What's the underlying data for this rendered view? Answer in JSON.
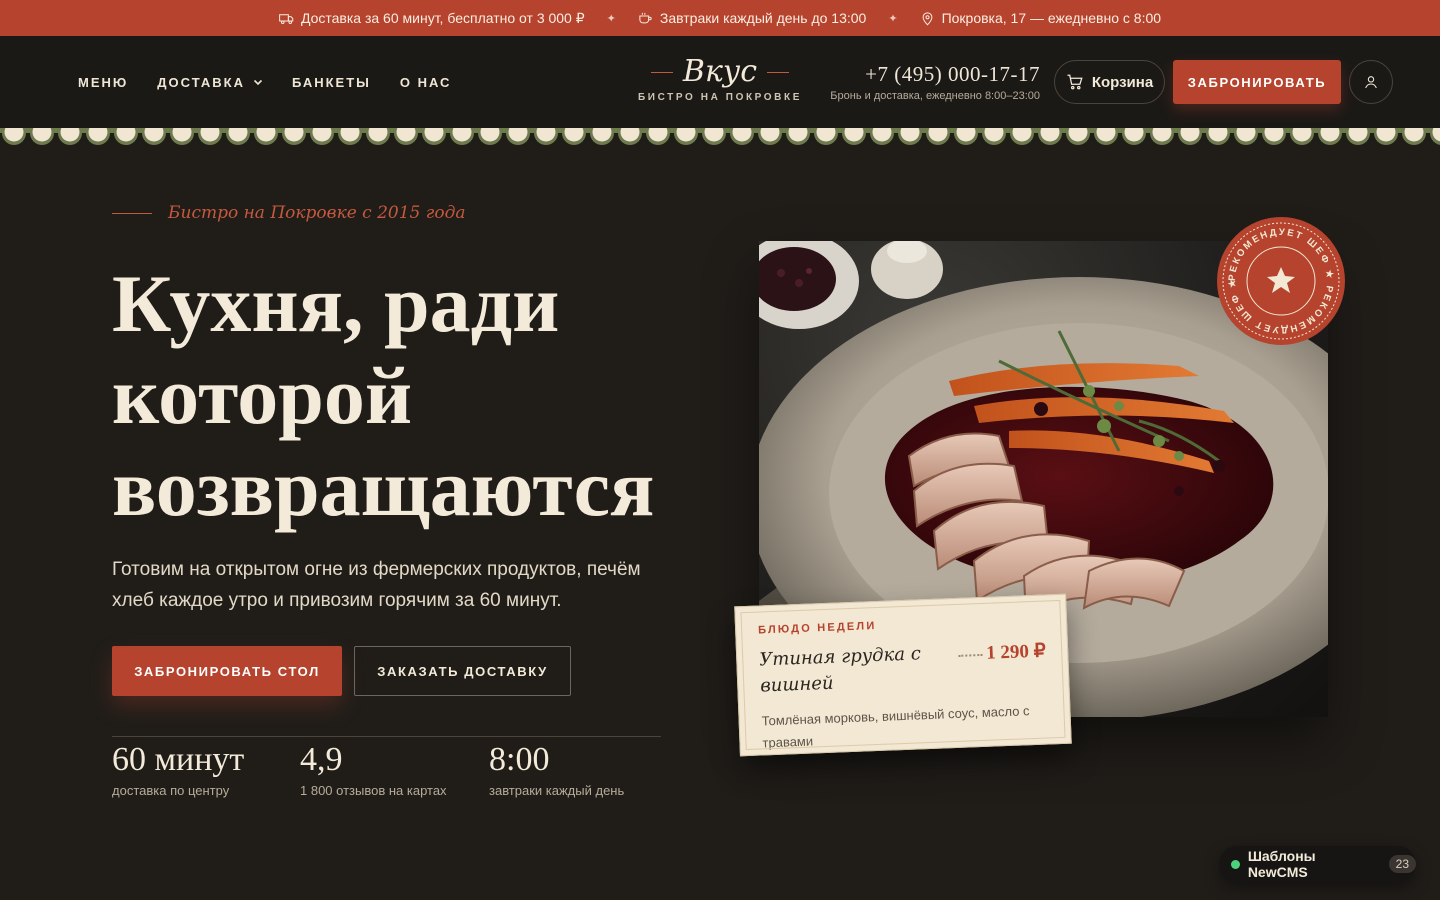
{
  "topbar": {
    "delivery": "Доставка за 60 минут, бесплатно от 3 000 ₽",
    "breakfast": "Завтраки каждый день до 13:00",
    "address": "Покровка, 17 — ежедневно с 8:00",
    "separator": "✦"
  },
  "nav": {
    "menu": "МЕНЮ",
    "delivery": "ДОСТАВКА",
    "banquets": "БАНКЕТЫ",
    "about": "О НАС"
  },
  "logo": {
    "name": "Вкус",
    "subtitle": "БИСТРО НА ПОКРОВКЕ"
  },
  "contact": {
    "phone": "+7 (495) 000-17-17",
    "note": "Бронь и доставка, ежедневно 8:00–23:00"
  },
  "header_buttons": {
    "cart": "Корзина",
    "book": "ЗАБРОНИРОВАТЬ"
  },
  "hero": {
    "eyebrow": "Бистро на Покровке с 2015 года",
    "headline": [
      "Кухня, ради",
      "которой",
      "возвращаются"
    ],
    "lead": "Готовим на открытом огне из фермерских продуктов, печём хлеб каждое утро и привозим горячим за 60 минут.",
    "cta_primary": "ЗАБРОНИРОВАТЬ СТОЛ",
    "cta_secondary": "ЗАКАЗАТЬ ДОСТАВКУ",
    "stats": [
      {
        "value": "60 минут",
        "label": "доставка по центру"
      },
      {
        "value": "4,9",
        "label": "1 800 отзывов на картах"
      },
      {
        "value": "8:00",
        "label": "завтраки каждый день"
      }
    ]
  },
  "badge": {
    "text": "РЕКОМЕНДУЕТ ШЕФ ★ РЕКОМЕНДУЕТ ШЕФ ★"
  },
  "dish_card": {
    "tag": "БЛЮДО НЕДЕЛИ",
    "name": "Утиная грудка с вишней",
    "price": "1 290 ₽",
    "description": "Томлёная морковь, вишнёвый соус, масло с травами"
  },
  "widget": {
    "label": "Шаблоны NewCMS",
    "count": "23"
  },
  "colors": {
    "accent": "#b5432d",
    "background": "#201d19",
    "cream": "#f3e8d3",
    "scallop_green": "#6e7b4e",
    "online_dot": "#4cd27a"
  }
}
